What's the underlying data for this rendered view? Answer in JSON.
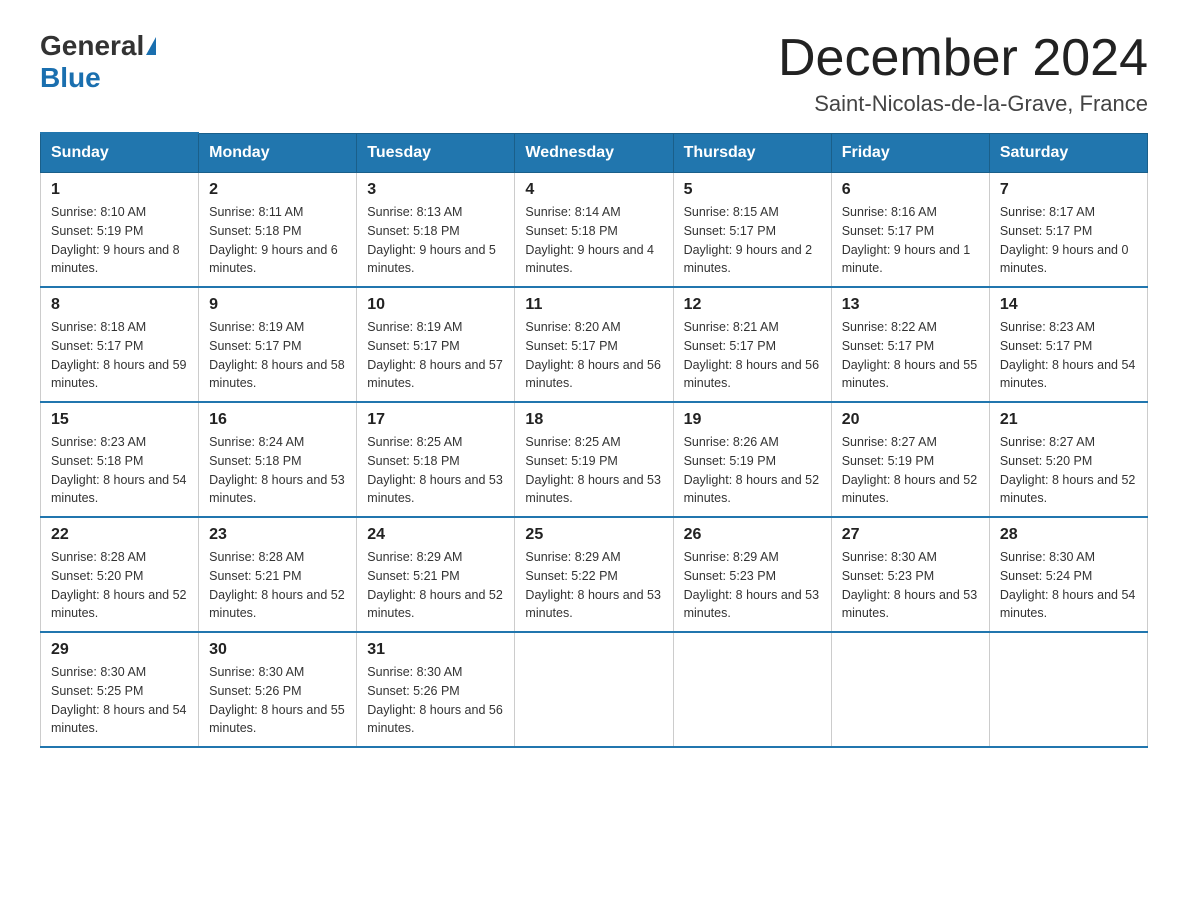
{
  "logo": {
    "general": "General",
    "blue": "Blue"
  },
  "title": "December 2024",
  "location": "Saint-Nicolas-de-la-Grave, France",
  "weekdays": [
    "Sunday",
    "Monday",
    "Tuesday",
    "Wednesday",
    "Thursday",
    "Friday",
    "Saturday"
  ],
  "weeks": [
    [
      {
        "day": "1",
        "sunrise": "8:10 AM",
        "sunset": "5:19 PM",
        "daylight": "9 hours and 8 minutes."
      },
      {
        "day": "2",
        "sunrise": "8:11 AM",
        "sunset": "5:18 PM",
        "daylight": "9 hours and 6 minutes."
      },
      {
        "day": "3",
        "sunrise": "8:13 AM",
        "sunset": "5:18 PM",
        "daylight": "9 hours and 5 minutes."
      },
      {
        "day": "4",
        "sunrise": "8:14 AM",
        "sunset": "5:18 PM",
        "daylight": "9 hours and 4 minutes."
      },
      {
        "day": "5",
        "sunrise": "8:15 AM",
        "sunset": "5:17 PM",
        "daylight": "9 hours and 2 minutes."
      },
      {
        "day": "6",
        "sunrise": "8:16 AM",
        "sunset": "5:17 PM",
        "daylight": "9 hours and 1 minute."
      },
      {
        "day": "7",
        "sunrise": "8:17 AM",
        "sunset": "5:17 PM",
        "daylight": "9 hours and 0 minutes."
      }
    ],
    [
      {
        "day": "8",
        "sunrise": "8:18 AM",
        "sunset": "5:17 PM",
        "daylight": "8 hours and 59 minutes."
      },
      {
        "day": "9",
        "sunrise": "8:19 AM",
        "sunset": "5:17 PM",
        "daylight": "8 hours and 58 minutes."
      },
      {
        "day": "10",
        "sunrise": "8:19 AM",
        "sunset": "5:17 PM",
        "daylight": "8 hours and 57 minutes."
      },
      {
        "day": "11",
        "sunrise": "8:20 AM",
        "sunset": "5:17 PM",
        "daylight": "8 hours and 56 minutes."
      },
      {
        "day": "12",
        "sunrise": "8:21 AM",
        "sunset": "5:17 PM",
        "daylight": "8 hours and 56 minutes."
      },
      {
        "day": "13",
        "sunrise": "8:22 AM",
        "sunset": "5:17 PM",
        "daylight": "8 hours and 55 minutes."
      },
      {
        "day": "14",
        "sunrise": "8:23 AM",
        "sunset": "5:17 PM",
        "daylight": "8 hours and 54 minutes."
      }
    ],
    [
      {
        "day": "15",
        "sunrise": "8:23 AM",
        "sunset": "5:18 PM",
        "daylight": "8 hours and 54 minutes."
      },
      {
        "day": "16",
        "sunrise": "8:24 AM",
        "sunset": "5:18 PM",
        "daylight": "8 hours and 53 minutes."
      },
      {
        "day": "17",
        "sunrise": "8:25 AM",
        "sunset": "5:18 PM",
        "daylight": "8 hours and 53 minutes."
      },
      {
        "day": "18",
        "sunrise": "8:25 AM",
        "sunset": "5:19 PM",
        "daylight": "8 hours and 53 minutes."
      },
      {
        "day": "19",
        "sunrise": "8:26 AM",
        "sunset": "5:19 PM",
        "daylight": "8 hours and 52 minutes."
      },
      {
        "day": "20",
        "sunrise": "8:27 AM",
        "sunset": "5:19 PM",
        "daylight": "8 hours and 52 minutes."
      },
      {
        "day": "21",
        "sunrise": "8:27 AM",
        "sunset": "5:20 PM",
        "daylight": "8 hours and 52 minutes."
      }
    ],
    [
      {
        "day": "22",
        "sunrise": "8:28 AM",
        "sunset": "5:20 PM",
        "daylight": "8 hours and 52 minutes."
      },
      {
        "day": "23",
        "sunrise": "8:28 AM",
        "sunset": "5:21 PM",
        "daylight": "8 hours and 52 minutes."
      },
      {
        "day": "24",
        "sunrise": "8:29 AM",
        "sunset": "5:21 PM",
        "daylight": "8 hours and 52 minutes."
      },
      {
        "day": "25",
        "sunrise": "8:29 AM",
        "sunset": "5:22 PM",
        "daylight": "8 hours and 53 minutes."
      },
      {
        "day": "26",
        "sunrise": "8:29 AM",
        "sunset": "5:23 PM",
        "daylight": "8 hours and 53 minutes."
      },
      {
        "day": "27",
        "sunrise": "8:30 AM",
        "sunset": "5:23 PM",
        "daylight": "8 hours and 53 minutes."
      },
      {
        "day": "28",
        "sunrise": "8:30 AM",
        "sunset": "5:24 PM",
        "daylight": "8 hours and 54 minutes."
      }
    ],
    [
      {
        "day": "29",
        "sunrise": "8:30 AM",
        "sunset": "5:25 PM",
        "daylight": "8 hours and 54 minutes."
      },
      {
        "day": "30",
        "sunrise": "8:30 AM",
        "sunset": "5:26 PM",
        "daylight": "8 hours and 55 minutes."
      },
      {
        "day": "31",
        "sunrise": "8:30 AM",
        "sunset": "5:26 PM",
        "daylight": "8 hours and 56 minutes."
      },
      null,
      null,
      null,
      null
    ]
  ],
  "labels": {
    "sunrise": "Sunrise:",
    "sunset": "Sunset:",
    "daylight": "Daylight:"
  }
}
